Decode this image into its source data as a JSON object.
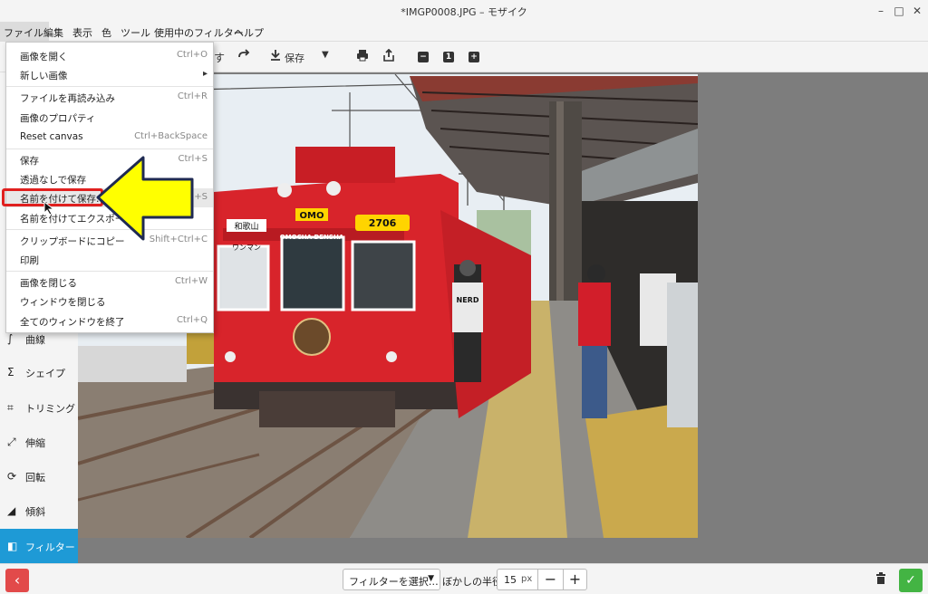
{
  "window": {
    "title": "*IMGP0008.JPG – モザイク"
  },
  "menubar": {
    "items": [
      "ファイル",
      "編集",
      "表示",
      "色",
      "ツール",
      "使用中のフィルター",
      "ヘルプ"
    ]
  },
  "toolbar": {
    "partial_label": "す",
    "save_label": "保存"
  },
  "file_menu": {
    "items": [
      {
        "label": "画像を開く",
        "shortcut": "Ctrl+O"
      },
      {
        "label": "新しい画像",
        "shortcut": "▸"
      },
      {
        "label": "ファイルを再読み込み",
        "shortcut": "Ctrl+R"
      },
      {
        "label": "画像のプロパティ",
        "shortcut": ""
      },
      {
        "label": "Reset canvas",
        "shortcut": "Ctrl+BackSpace"
      },
      {
        "label": "保存",
        "shortcut": "Ctrl+S"
      },
      {
        "label": "透過なしで保存",
        "shortcut": ""
      },
      {
        "label": "名前を付けて保存…",
        "shortcut": "+S"
      },
      {
        "label": "名前を付けてエクスポート",
        "shortcut": ""
      },
      {
        "label": "クリップボードにコピー",
        "shortcut": "Shift+Ctrl+C"
      },
      {
        "label": "印刷",
        "shortcut": ""
      },
      {
        "label": "画像を閉じる",
        "shortcut": "Ctrl+W"
      },
      {
        "label": "ウィンドウを閉じる",
        "shortcut": ""
      },
      {
        "label": "全てのウィンドウを終了",
        "shortcut": "Ctrl+Q"
      }
    ]
  },
  "sidebar": {
    "items": [
      {
        "label": "曲線",
        "icon": "curve-icon"
      },
      {
        "label": "シェイプ",
        "icon": "shape-icon"
      },
      {
        "label": "トリミング",
        "icon": "crop-icon"
      },
      {
        "label": "伸縮",
        "icon": "scale-icon"
      },
      {
        "label": "回転",
        "icon": "rotate-icon"
      },
      {
        "label": "傾斜",
        "icon": "skew-icon"
      },
      {
        "label": "フィルター",
        "icon": "filter-icon"
      }
    ]
  },
  "bottombar": {
    "filter_select": "フィルターを選択…",
    "blur_label": "ぼかしの半径",
    "blur_value": "15",
    "blur_unit": "px"
  },
  "photo": {
    "omo_sign": "OMO",
    "car_number": "2706",
    "destination_sign": "和歌山",
    "wanman": "ワンマン",
    "train_name": "OMOCHA DENSHA",
    "shirt_text": "NERD"
  },
  "colors": {
    "accent": "#1e9ad6",
    "train_red": "#d8242b",
    "highlight_box": "#e0201f",
    "arrow_fill": "#ffff00"
  }
}
